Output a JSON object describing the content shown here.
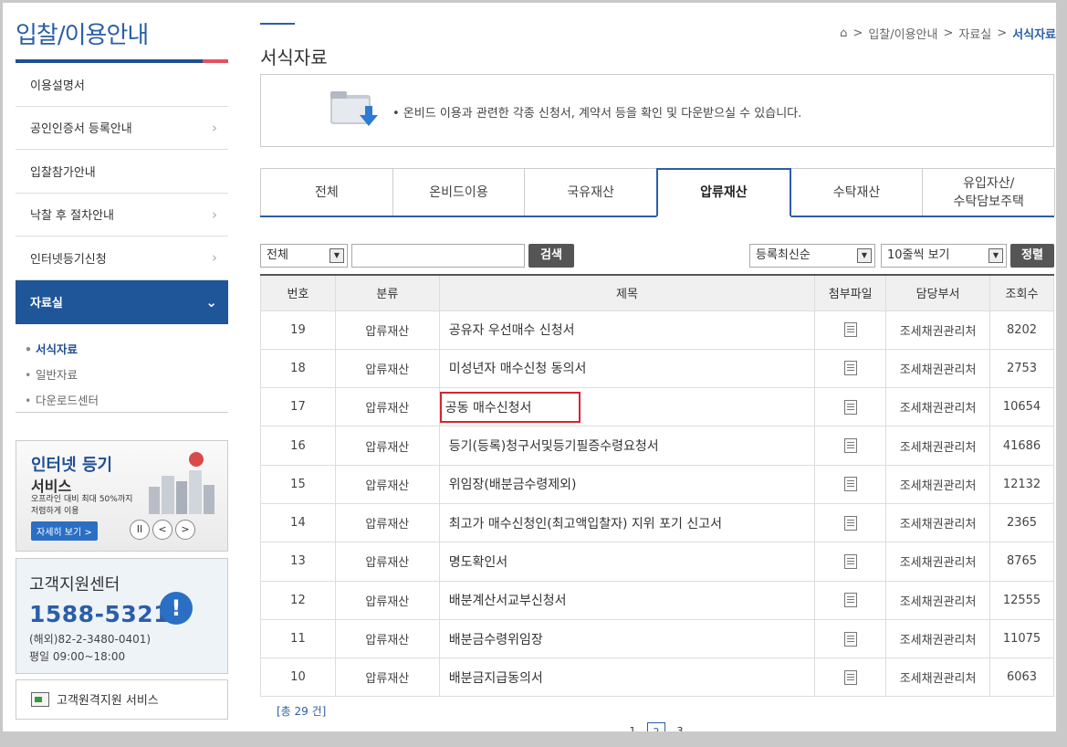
{
  "sidebar": {
    "title": "입찰/이용안내",
    "menu": [
      {
        "label": "이용설명서",
        "chevron": false
      },
      {
        "label": "공인인증서 등록안내",
        "chevron": true
      },
      {
        "label": "입찰참가안내",
        "chevron": false
      },
      {
        "label": "낙찰 후 절차안내",
        "chevron": true
      },
      {
        "label": "인터넷등기신청",
        "chevron": true
      }
    ],
    "active_menu": "자료실",
    "submenu": [
      {
        "label": "서식자료",
        "current": true
      },
      {
        "label": "일반자료",
        "current": false
      },
      {
        "label": "다운로드센터",
        "current": false
      }
    ],
    "banner": {
      "title": "인터넷 등기",
      "subtitle": "서비스",
      "desc": "오프라인 대비 최대 50%까지 저렴하게 이용",
      "button": "자세히 보기 >"
    },
    "support": {
      "title": "고객지원센터",
      "phone": "1588-5321",
      "overseas": "(해외)82-2-3480-0401)",
      "hours": "평일 09:00~18:00"
    },
    "remote_label": "고객원격지원 서비스"
  },
  "main": {
    "title": "서식자료",
    "breadcrumb": [
      "입찰/이용안내",
      "자료실",
      "서식자료"
    ],
    "info_text": "• 온비드 이용과 관련한 각종 신청서, 계약서 등을 확인 및 다운받으실 수 있습니다.",
    "tabs": [
      {
        "label": "전체",
        "active": false
      },
      {
        "label": "온비드이용",
        "active": false
      },
      {
        "label": "국유재산",
        "active": false
      },
      {
        "label": "압류재산",
        "active": true
      },
      {
        "label": "수탁재산",
        "active": false
      },
      {
        "label": "유입자산/\n수탁담보주택",
        "active": false
      }
    ],
    "filter": {
      "category_value": "전체",
      "search_placeholder": "",
      "search_button": "검색",
      "sort_value": "등록최신순",
      "page_size_value": "10줄씩 보기",
      "sort_button": "정렬"
    },
    "table": {
      "headers": [
        "번호",
        "분류",
        "제목",
        "첨부파일",
        "담당부서",
        "조회수"
      ],
      "rows": [
        {
          "no": "19",
          "category": "압류재산",
          "subject": "공유자 우선매수 신청서",
          "dept": "조세채권관리처",
          "views": "8202"
        },
        {
          "no": "18",
          "category": "압류재산",
          "subject": "미성년자 매수신청 동의서",
          "dept": "조세채권관리처",
          "views": "2753"
        },
        {
          "no": "17",
          "category": "압류재산",
          "subject": "공동 매수신청서",
          "dept": "조세채권관리처",
          "views": "10654",
          "highlight": true
        },
        {
          "no": "16",
          "category": "압류재산",
          "subject": "등기(등록)청구서및등기필증수령요청서",
          "dept": "조세채권관리처",
          "views": "41686"
        },
        {
          "no": "15",
          "category": "압류재산",
          "subject": "위임장(배분금수령제외)",
          "dept": "조세채권관리처",
          "views": "12132"
        },
        {
          "no": "14",
          "category": "압류재산",
          "subject": "최고가 매수신청인(최고액입찰자) 지위 포기 신고서",
          "dept": "조세채권관리처",
          "views": "2365"
        },
        {
          "no": "13",
          "category": "압류재산",
          "subject": "명도확인서",
          "dept": "조세채권관리처",
          "views": "8765"
        },
        {
          "no": "12",
          "category": "압류재산",
          "subject": "배분계산서교부신청서",
          "dept": "조세채권관리처",
          "views": "12555"
        },
        {
          "no": "11",
          "category": "압류재산",
          "subject": "배분금수령위임장",
          "dept": "조세채권관리처",
          "views": "11075"
        },
        {
          "no": "10",
          "category": "압류재산",
          "subject": "배분금지급동의서",
          "dept": "조세채권관리처",
          "views": "6063"
        }
      ]
    },
    "total_text": "[총 29 건]",
    "pages": [
      "1",
      "2",
      "3"
    ],
    "current_page": "2"
  }
}
